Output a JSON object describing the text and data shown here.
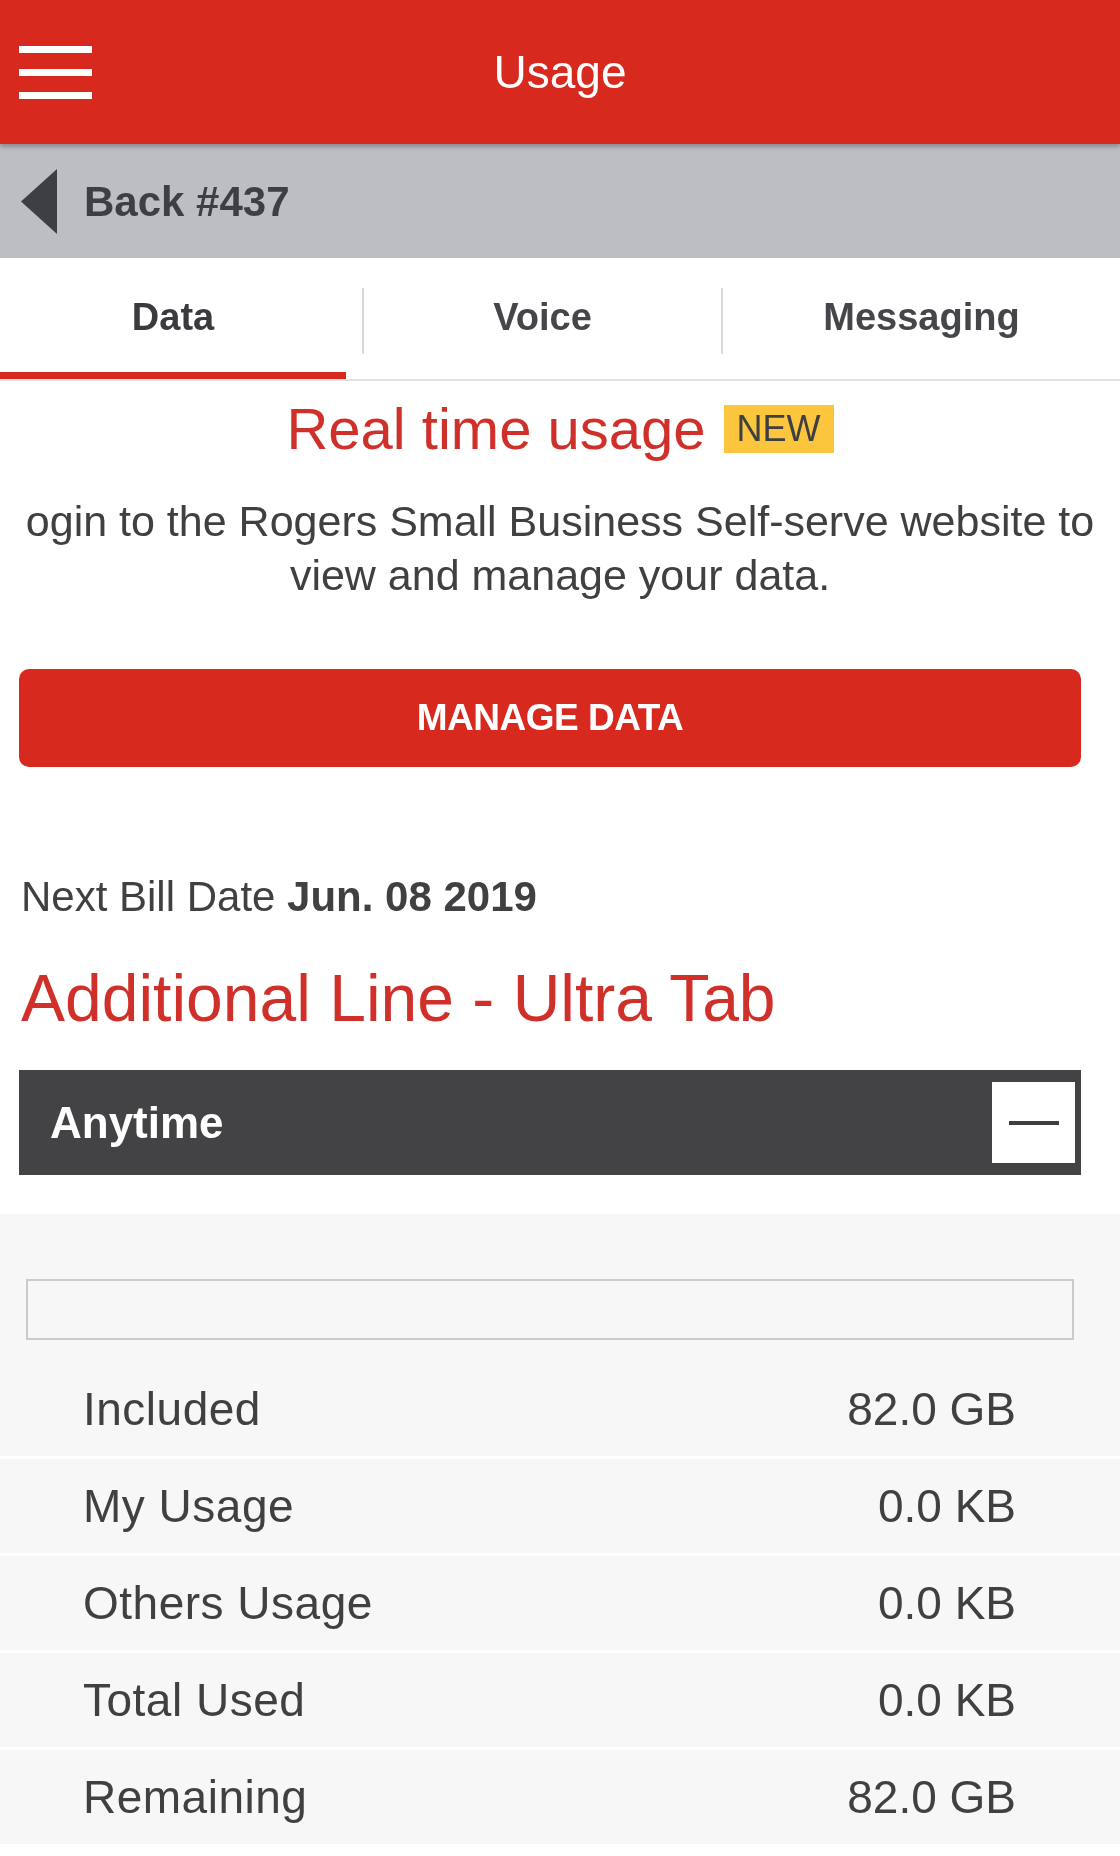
{
  "header": {
    "title": "Usage"
  },
  "back_bar": {
    "label": "Back #437"
  },
  "tabs": [
    {
      "label": "Data",
      "selected": true
    },
    {
      "label": "Voice",
      "selected": false
    },
    {
      "label": "Messaging",
      "selected": false
    }
  ],
  "promo": {
    "title": "Real time usage",
    "badge": "NEW",
    "text": "ogin to the Rogers Small Business Self-serve website to view and manage your data.",
    "button": "MANAGE DATA"
  },
  "bill": {
    "text": "Next Bill Date **Jun. 08 2019**"
  },
  "plan": {
    "title": "Additional Line - Ultra Tab",
    "section": {
      "title": "Anytime",
      "expanded": true,
      "rows": [
        {
          "label": "Included",
          "value": "82.0 GB"
        },
        {
          "label": "My Usage",
          "value": "0.0 KB"
        },
        {
          "label": "Others Usage",
          "value": "0.0 KB"
        },
        {
          "label": "Total Used",
          "value": "0.0 KB"
        },
        {
          "label": "Remaining",
          "value": "82.0 GB"
        }
      ]
    }
  }
}
